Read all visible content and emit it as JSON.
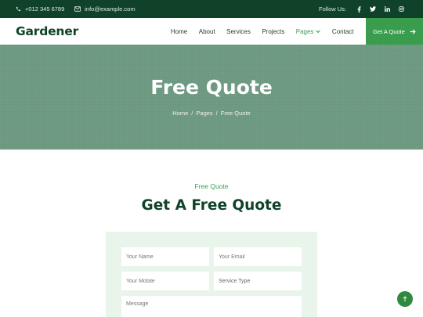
{
  "topbar": {
    "phone": "+012 345 6789",
    "email": "info@example.com",
    "follow_label": "Follow Us:",
    "social_icons": [
      "facebook-icon",
      "twitter-icon",
      "linkedin-icon",
      "instagram-icon"
    ]
  },
  "navbar": {
    "brand": "Gardener",
    "items": [
      {
        "label": "Home"
      },
      {
        "label": "About"
      },
      {
        "label": "Services"
      },
      {
        "label": "Projects"
      },
      {
        "label": "Pages",
        "active": true,
        "dropdown": true
      },
      {
        "label": "Contact"
      }
    ],
    "cta_label": "Get A Quote"
  },
  "hero": {
    "title": "Free Quote",
    "breadcrumb": [
      "Home",
      "Pages",
      "Free Quote"
    ],
    "separator": "/"
  },
  "section": {
    "eyebrow": "Free Quote",
    "title": "Get A Free Quote"
  },
  "form": {
    "name_placeholder": "Your Name",
    "email_placeholder": "Your Email",
    "mobile_placeholder": "Your Mobile",
    "service_placeholder": "Service Type",
    "message_placeholder": "Message"
  },
  "colors": {
    "dark_green": "#0f4229",
    "accent_green": "#3a9d4e",
    "hero_overlay": "#6e9a82",
    "form_bg": "#e9f4ea"
  }
}
